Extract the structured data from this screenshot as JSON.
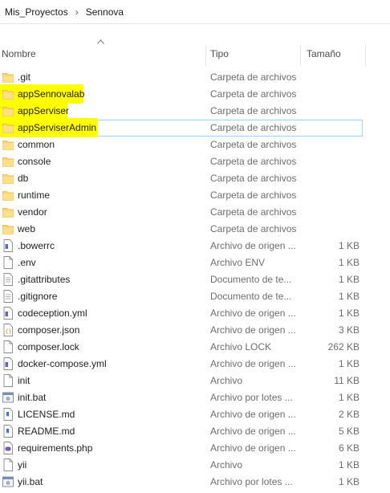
{
  "breadcrumb": {
    "items": [
      "Mis_Proyectos",
      "Sennova"
    ],
    "separator": "›"
  },
  "columns": {
    "name": "Nombre",
    "type": "Tipo",
    "size": "Tamaño"
  },
  "colors": {
    "folder": "#ffd766",
    "highlight": "#ffff00",
    "selection_border": "#99d1ff"
  },
  "files": [
    {
      "name": ".git",
      "type": "Carpeta de archivos",
      "size": "",
      "icon": "folder-icon",
      "highlight": false
    },
    {
      "name": "appSennovalab",
      "type": "Carpeta de archivos",
      "size": "",
      "icon": "folder-icon",
      "highlight": true
    },
    {
      "name": "appServiser",
      "type": "Carpeta de archivos",
      "size": "",
      "icon": "folder-icon",
      "highlight": true
    },
    {
      "name": "appServiserAdmin",
      "type": "Carpeta de archivos",
      "size": "",
      "icon": "folder-icon",
      "highlight": true,
      "selected": true
    },
    {
      "name": "common",
      "type": "Carpeta de archivos",
      "size": "",
      "icon": "folder-icon",
      "highlight": false
    },
    {
      "name": "console",
      "type": "Carpeta de archivos",
      "size": "",
      "icon": "folder-icon",
      "highlight": false
    },
    {
      "name": "db",
      "type": "Carpeta de archivos",
      "size": "",
      "icon": "folder-icon",
      "highlight": false
    },
    {
      "name": "runtime",
      "type": "Carpeta de archivos",
      "size": "",
      "icon": "folder-icon",
      "highlight": false
    },
    {
      "name": "vendor",
      "type": "Carpeta de archivos",
      "size": "",
      "icon": "folder-icon",
      "highlight": false
    },
    {
      "name": "web",
      "type": "Carpeta de archivos",
      "size": "",
      "icon": "folder-icon",
      "highlight": false
    },
    {
      "name": ".bowerrc",
      "type": "Archivo de origen ...",
      "size": "1 KB",
      "icon": "source-file-icon",
      "highlight": false
    },
    {
      "name": ".env",
      "type": "Archivo ENV",
      "size": "1 KB",
      "icon": "blank-file-icon",
      "highlight": false
    },
    {
      "name": ".gitattributes",
      "type": "Documento de te...",
      "size": "1 KB",
      "icon": "text-file-icon",
      "highlight": false
    },
    {
      "name": ".gitignore",
      "type": "Documento de te...",
      "size": "1 KB",
      "icon": "text-file-icon",
      "highlight": false
    },
    {
      "name": "codeception.yml",
      "type": "Archivo de origen ...",
      "size": "1 KB",
      "icon": "source-file-icon",
      "highlight": false
    },
    {
      "name": "composer.json",
      "type": "Archivo de origen ...",
      "size": "3 KB",
      "icon": "json-file-icon",
      "highlight": false
    },
    {
      "name": "composer.lock",
      "type": "Archivo LOCK",
      "size": "262 KB",
      "icon": "blank-file-icon",
      "highlight": false
    },
    {
      "name": "docker-compose.yml",
      "type": "Archivo de origen ...",
      "size": "1 KB",
      "icon": "source-file-icon",
      "highlight": false
    },
    {
      "name": "init",
      "type": "Archivo",
      "size": "11 KB",
      "icon": "blank-file-icon",
      "highlight": false
    },
    {
      "name": "init.bat",
      "type": "Archivo por lotes ...",
      "size": "1 KB",
      "icon": "batch-file-icon",
      "highlight": false
    },
    {
      "name": "LICENSE.md",
      "type": "Archivo de origen ...",
      "size": "2 KB",
      "icon": "markdown-file-icon",
      "highlight": false
    },
    {
      "name": "README.md",
      "type": "Archivo de origen ...",
      "size": "5 KB",
      "icon": "markdown-file-icon",
      "highlight": false
    },
    {
      "name": "requirements.php",
      "type": "Archivo de origen ...",
      "size": "6 KB",
      "icon": "php-file-icon",
      "highlight": false
    },
    {
      "name": "yii",
      "type": "Archivo",
      "size": "1 KB",
      "icon": "blank-file-icon",
      "highlight": false
    },
    {
      "name": "yii.bat",
      "type": "Archivo por lotes ...",
      "size": "1 KB",
      "icon": "batch-file-icon",
      "highlight": false
    }
  ]
}
